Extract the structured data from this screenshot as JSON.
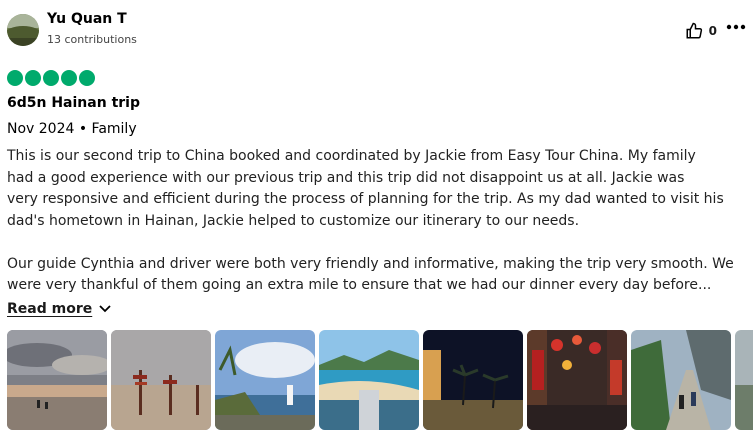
{
  "review": {
    "user_name": "Yu Quan T",
    "contributions": "13 contributions",
    "like_count": "0",
    "rating": 5,
    "title": "6d5n Hainan trip",
    "meta": "Nov 2024 • Family",
    "body_lines": [
      "This is our second trip to China booked and coordinated by Jackie from Easy Tour China. My family",
      "had a good experience with our previous trip and this trip did not disappoint us at all. Jackie was",
      "very responsive and efficient during the process of planning for the trip. As my dad wanted to visit his",
      "dad's hometown in Hainan, Jackie helped to customize our itinerary to our needs.",
      "",
      "Our guide Cynthia and driver were both very friendly and informative, making the trip very smooth. We",
      "were very thankful of them going an extra mile to ensure that we had our dinner every day before..."
    ],
    "read_more_label": "Read more"
  },
  "colors": {
    "rating_green": "#00aa6c"
  },
  "icons": {
    "like": "thumbs-up-icon",
    "more": "ellipsis-icon",
    "read_more": "chevron-down-icon"
  },
  "photos": [
    {
      "name": "photo-cloudy-beach"
    },
    {
      "name": "photo-signposts-beach"
    },
    {
      "name": "photo-coast-lighthouse"
    },
    {
      "name": "photo-bay-aerial"
    },
    {
      "name": "photo-night-palms"
    },
    {
      "name": "photo-lantern-street"
    },
    {
      "name": "photo-mountain-bridge"
    },
    {
      "name": "photo-partial"
    }
  ]
}
